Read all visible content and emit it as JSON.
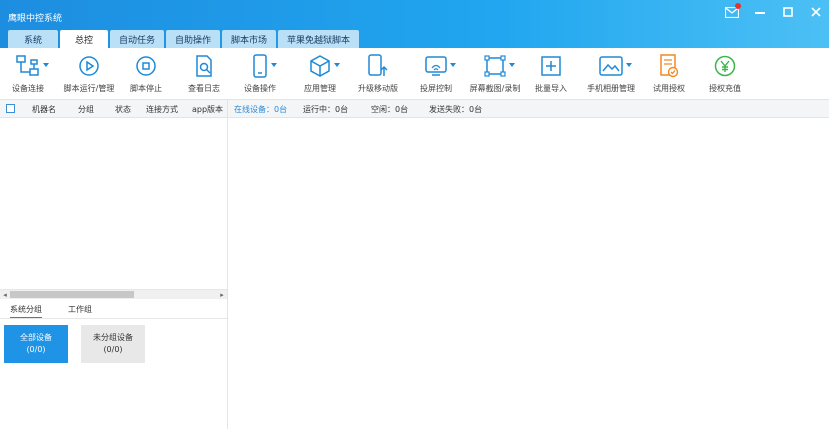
{
  "app": {
    "title": "鹰眼中控系统"
  },
  "window_controls": {
    "mail": "mail-icon",
    "minimize": "minimize-icon",
    "maximize": "maximize-icon",
    "close": "close-icon"
  },
  "tabs": [
    {
      "label": "系统"
    },
    {
      "label": "总控"
    },
    {
      "label": "自动任务"
    },
    {
      "label": "自助操作"
    },
    {
      "label": "脚本市场"
    },
    {
      "label": "苹果免越狱脚本"
    }
  ],
  "toolbar": [
    {
      "label": "设备连接",
      "icon": "device-connect-icon",
      "dropdown": true
    },
    {
      "label": "脚本运行/管理",
      "icon": "play-circle-icon"
    },
    {
      "label": "脚本停止",
      "icon": "stop-circle-icon"
    },
    {
      "label": "查看日志",
      "icon": "log-search-icon"
    },
    {
      "label": "设备操作",
      "icon": "phone-icon",
      "dropdown": true
    },
    {
      "label": "应用管理",
      "icon": "cube-icon",
      "dropdown": true
    },
    {
      "label": "升级移动版",
      "icon": "upgrade-mobile-icon"
    },
    {
      "label": "投屏控制",
      "icon": "cast-icon",
      "dropdown": true
    },
    {
      "label": "屏幕截图/录制",
      "icon": "screenshot-icon",
      "dropdown": true
    },
    {
      "label": "批量导入",
      "icon": "batch-import-icon"
    },
    {
      "label": "手机相册管理",
      "icon": "album-icon",
      "dropdown": true
    },
    {
      "label": "试用授权",
      "icon": "trial-license-icon"
    },
    {
      "label": "授权充值",
      "icon": "yuan-recharge-icon"
    }
  ],
  "columns": [
    "机器名",
    "分组",
    "状态",
    "连接方式",
    "app版本"
  ],
  "status": {
    "online": "在线设备：0台",
    "running": "运行中：0台",
    "idle": "空闲：0台",
    "failed": "发送失败：0台"
  },
  "group_tabs": [
    "系统分组",
    "工作组"
  ],
  "groups": [
    {
      "name": "全部设备",
      "count": "(0/0)"
    },
    {
      "name": "未分组设备",
      "count": "(0/0)"
    }
  ],
  "colors": {
    "accent": "#1f93e6",
    "title_gradient_start": "#1d8de0",
    "title_gradient_end": "#4cc0f5",
    "orange": "#f08a24",
    "green": "#3bb54a"
  }
}
